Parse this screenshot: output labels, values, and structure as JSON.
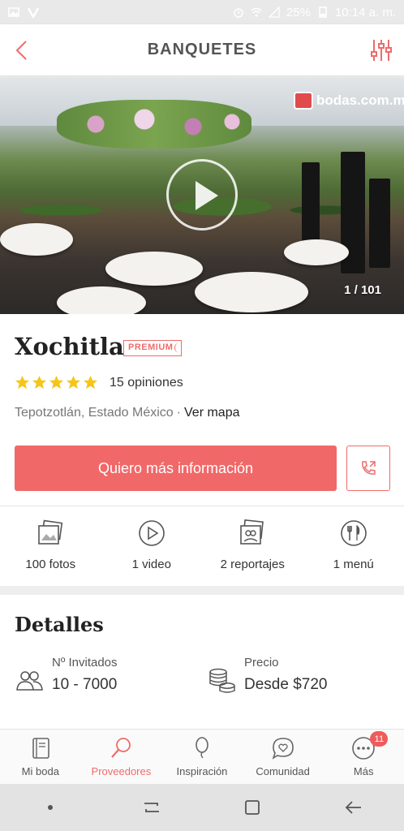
{
  "status_bar": {
    "battery": "25%",
    "time": "10:14 a. m."
  },
  "header": {
    "title": "BANQUETES"
  },
  "gallery": {
    "watermark": "bodas.com.mx",
    "counter": "1 / 101"
  },
  "vendor": {
    "name": "Xochitla",
    "badge": "PREMIUM",
    "rating_stars": 5,
    "reviews": "15 opiniones",
    "location": "Tepotzotlán, Estado México",
    "separator": "·",
    "map_link": "Ver mapa"
  },
  "actions": {
    "cta_label": "Quiero más información"
  },
  "media": [
    {
      "icon": "photos-icon",
      "label": "100 fotos"
    },
    {
      "icon": "video-icon",
      "label": "1 video"
    },
    {
      "icon": "reports-icon",
      "label": "2 reportajes"
    },
    {
      "icon": "menu-icon",
      "label": "1 menú"
    }
  ],
  "details": {
    "title": "Detalles",
    "guests_label": "Nº Invitados",
    "guests_value": "10 - 7000",
    "price_label": "Precio",
    "price_value": "Desde $720"
  },
  "bottom_nav": [
    {
      "icon": "notebook-icon",
      "label": "Mi boda"
    },
    {
      "icon": "search-icon",
      "label": "Proveedores",
      "active": true
    },
    {
      "icon": "balloon-icon",
      "label": "Inspiración"
    },
    {
      "icon": "chat-heart-icon",
      "label": "Comunidad"
    },
    {
      "icon": "more-icon",
      "label": "Más",
      "badge": "11"
    }
  ],
  "colors": {
    "accent": "#f16868",
    "star": "#f5c518"
  }
}
